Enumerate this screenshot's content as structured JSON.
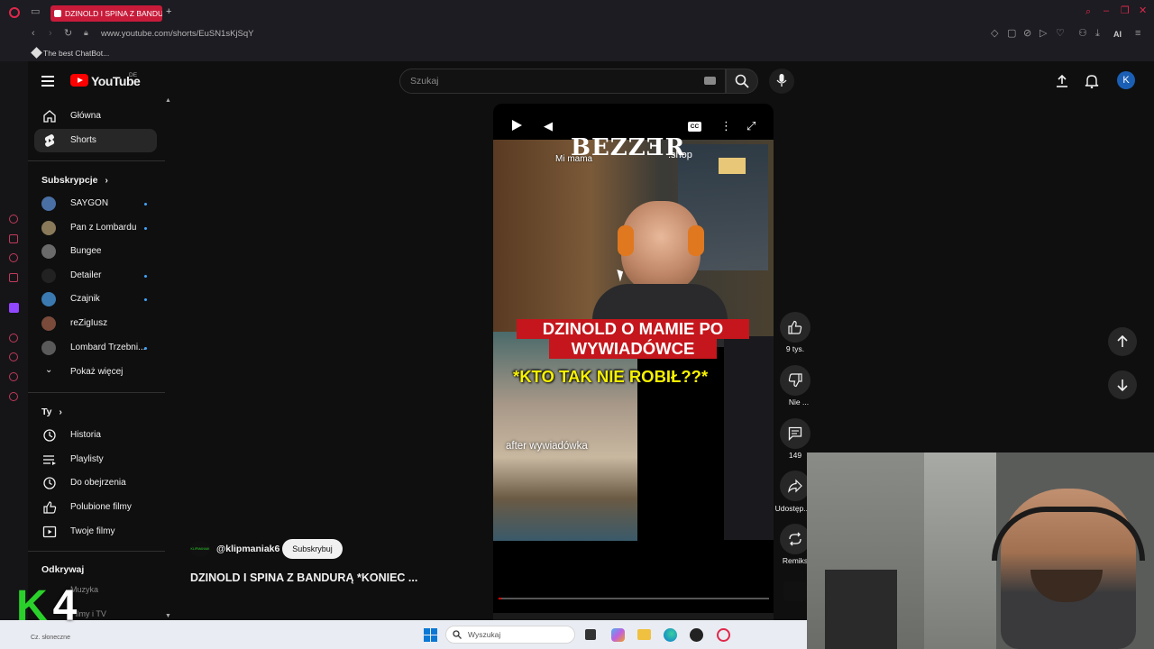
{
  "browser": {
    "tab_title": "DZINOLD I SPINA Z BANDU",
    "url": "www.youtube.com/shorts/EuSN1sKjSqY",
    "bookmark": "The best ChatBot...",
    "ai_label": "AI"
  },
  "yt": {
    "logo_text": "YouTube",
    "region": "DE",
    "search_placeholder": "Szukaj",
    "avatar_letter": "K"
  },
  "sidebar": {
    "main": [
      {
        "label": "Główna",
        "icon": "home-icon"
      },
      {
        "label": "Shorts",
        "icon": "shorts-icon"
      }
    ],
    "subs_title": "Subskrypcje",
    "subs": [
      {
        "label": "SAYGON",
        "new": true,
        "color": "#4a6fa5"
      },
      {
        "label": "Pan z Lombardu",
        "new": true,
        "color": "#8a7a5a"
      },
      {
        "label": "Bungee",
        "new": false,
        "color": "#6a6a6a"
      },
      {
        "label": "Detailer",
        "new": true,
        "color": "#222222"
      },
      {
        "label": "Czajnik",
        "new": true,
        "color": "#3a7ab0"
      },
      {
        "label": "reZigIusz",
        "new": false,
        "color": "#7a4a3a"
      },
      {
        "label": "Lombard Trzebni...",
        "new": true,
        "color": "#5a5a5a"
      }
    ],
    "show_more": "Pokaż więcej",
    "you_title": "Ty",
    "you": [
      {
        "label": "Historia",
        "icon": "history-icon"
      },
      {
        "label": "Playlisty",
        "icon": "playlists-icon"
      },
      {
        "label": "Do obejrzenia",
        "icon": "watch-later-icon"
      },
      {
        "label": "Polubione filmy",
        "icon": "liked-icon"
      },
      {
        "label": "Twoje filmy",
        "icon": "your-videos-icon"
      }
    ],
    "explore_title": "Odkrywaj",
    "explore": [
      "Muzyka",
      "Filmy i TV"
    ]
  },
  "short": {
    "brand_overlay": "BEZZƎR",
    "brand_suffix": ".shop",
    "caption_top": "Mi mama",
    "title_line1": "DZINOLD O MAMIE PO",
    "title_line2": "WYWIADÓWCE",
    "title_line3": "*KTO TAK NIE ROBIŁ??*",
    "caption_bottom": "after wywiadówka",
    "channel": "@klipmaniak6",
    "channel_avatar_text": "KLIPMANIAK",
    "subscribe": "Subskrybuj",
    "title": "DZINOLD I SPINA Z BANDURĄ *KONIEC ...",
    "progress_fraction": 0.01
  },
  "actions": {
    "likes": "9 tys.",
    "dislike": "Nie ...",
    "comments": "149",
    "share": "Udostęp...",
    "remix": "Remiks"
  },
  "taskbar": {
    "search_placeholder": "Wyszukaj"
  },
  "overlay": {
    "k4_k": "K",
    "k4_4": "4",
    "weather": "Cz. słoneczne"
  }
}
